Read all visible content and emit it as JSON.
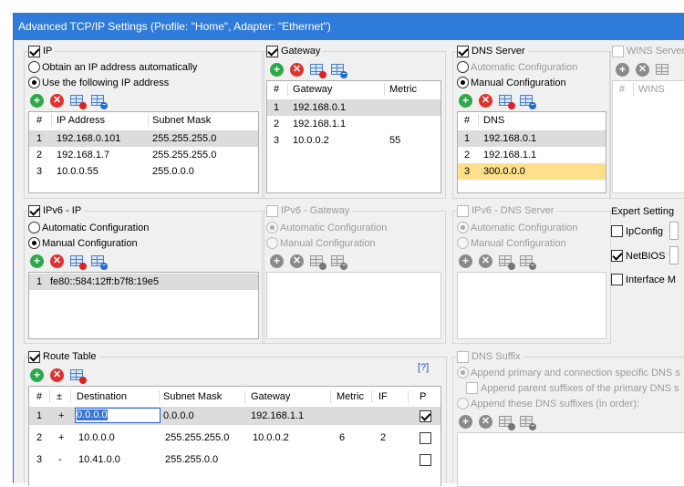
{
  "window": {
    "title": "Advanced TCP/IP Settings (Profile: \"Home\", Adapter: \"Ethernet\")"
  },
  "ip": {
    "title": "IP",
    "checked": true,
    "radio_auto": "Obtain an IP address automatically",
    "radio_manual": "Use the following IP address",
    "headers": [
      "#",
      "IP Address",
      "Subnet Mask"
    ],
    "rows": [
      [
        "1",
        "192.168.0.101",
        "255.255.255.0"
      ],
      [
        "2",
        "192.168.1.7",
        "255.255.255.0"
      ],
      [
        "3",
        "10.0.0.55",
        "255.0.0.0"
      ]
    ]
  },
  "gateway": {
    "title": "Gateway",
    "checked": true,
    "headers": [
      "#",
      "Gateway",
      "Metric"
    ],
    "rows": [
      [
        "1",
        "192.168.0.1",
        ""
      ],
      [
        "2",
        "192.168.1.1",
        ""
      ],
      [
        "3",
        "10.0.0.2",
        "55"
      ]
    ]
  },
  "dns": {
    "title": "DNS Server",
    "checked": true,
    "radio_auto": "Automatic Configuration",
    "radio_manual": "Manual Configuration",
    "headers": [
      "#",
      "DNS"
    ],
    "rows": [
      [
        "1",
        "192.168.0.1"
      ],
      [
        "2",
        "192.168.1.1"
      ],
      [
        "3",
        "300.0.0.0"
      ]
    ]
  },
  "wins": {
    "title": "WINS Server",
    "headers": [
      "#",
      "WINS"
    ]
  },
  "ipv6": {
    "title": "IPv6 - IP",
    "checked": true,
    "radio_auto": "Automatic Configuration",
    "radio_manual": "Manual Configuration",
    "rows": [
      [
        "1",
        "fe80::584:12ff:b7f8:19e5"
      ]
    ]
  },
  "ipv6_gateway": {
    "title": "IPv6 - Gateway",
    "radio_auto": "Automatic Configuration",
    "radio_manual": "Manual Configuration"
  },
  "ipv6_dns": {
    "title": "IPv6 - DNS Server",
    "radio_auto": "Automatic Configuration",
    "radio_manual": "Manual Configuration"
  },
  "expert": {
    "title": "Expert Setting",
    "ipconfig": "IpConfig",
    "netbios": "NetBIOS",
    "interface": "Interface M"
  },
  "route": {
    "title": "Route Table",
    "checked": true,
    "help": "[?]",
    "headers": [
      "#",
      "±",
      "Destination",
      "Subnet Mask",
      "Gateway",
      "Metric",
      "IF",
      "P"
    ],
    "rows": [
      [
        "1",
        "+",
        "0.0.0.0",
        "0.0.0.0",
        "192.168.1.1",
        "",
        "",
        "checked"
      ],
      [
        "2",
        "+",
        "10.0.0.0",
        "255.255.255.0",
        "10.0.0.2",
        "6",
        "2",
        ""
      ],
      [
        "3",
        "-",
        "10.41.0.0",
        "255.255.0.0",
        "",
        "",
        "",
        ""
      ]
    ]
  },
  "dns_suffix": {
    "title": "DNS Suffix",
    "opt1": "Append primary and connection specific DNS s",
    "opt2": "Append parent suffixes of the primary DNS s",
    "opt3": "Append these DNS suffixes (in order):"
  },
  "colors": {
    "titlebar": "#2f7bd9",
    "selected_row": "#dcdcdc",
    "invalid_row": "#ffe08a",
    "add": "#2fa84a",
    "delete": "#e03131"
  }
}
